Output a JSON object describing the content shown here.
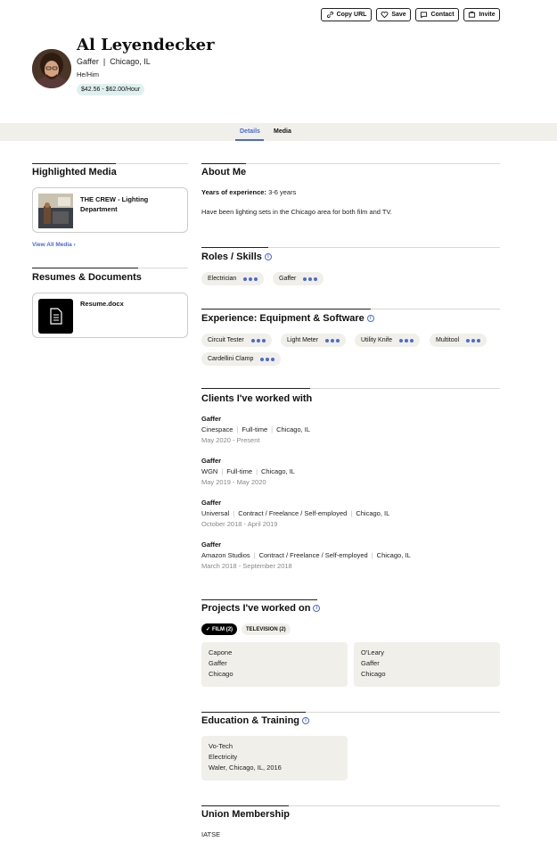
{
  "header": {
    "copy_url": "Copy URL",
    "save": "Save",
    "contact": "Contact",
    "invite": "Invite"
  },
  "profile": {
    "name": "Al Leyendecker",
    "role": "Gaffer",
    "location": "Chicago, IL",
    "pronouns": "He/Him",
    "rate": "$42.56 - $62.00/Hour"
  },
  "tabs": [
    "Details",
    "Media"
  ],
  "sidebar": {
    "highlighted_title": "Highlighted Media",
    "media_item": "THE CREW - Lighting Department",
    "view_all": "View All Media",
    "resumes_title": "Resumes & Documents",
    "resume_file": "Resume.docx"
  },
  "about": {
    "title": "About Me",
    "years_label": "Years of experience:",
    "years_value": "3-6 years",
    "bio": "Have been lighting sets in the Chicago area for both film and TV."
  },
  "roles": {
    "title": "Roles / Skills",
    "items": [
      "Electrician",
      "Gaffer"
    ]
  },
  "equipment": {
    "title": "Experience: Equipment & Software",
    "items": [
      "Circuit Tester",
      "Light Meter",
      "Utility Knife",
      "Multitool",
      "Cardellini Clamp"
    ]
  },
  "clients": {
    "title": "Clients I've worked with",
    "items": [
      {
        "role": "Gaffer",
        "company": "Cinespace",
        "type": "Full-time",
        "location": "Chicago, IL",
        "dates": "May 2020 - Present"
      },
      {
        "role": "Gaffer",
        "company": "WGN",
        "type": "Full-time",
        "location": "Chicago, IL",
        "dates": "May 2019 - May 2020"
      },
      {
        "role": "Gaffer",
        "company": "Universal",
        "type": "Contract / Freelance / Self-employed",
        "location": "Chicago, IL",
        "dates": "October 2018 - April 2019"
      },
      {
        "role": "Gaffer",
        "company": "Amazon Studios",
        "type": "Contract / Freelance / Self-employed",
        "location": "Chicago, IL",
        "dates": "March 2018 - September 2018"
      }
    ]
  },
  "projects": {
    "title": "Projects I've worked on",
    "filter_film": "FILM (2)",
    "filter_tv": "TELEVISION (2)",
    "items": [
      {
        "title": "Capone",
        "role": "Gaffer",
        "location": "Chicago"
      },
      {
        "title": "O'Leary",
        "role": "Gaffer",
        "location": "Chicago"
      }
    ]
  },
  "education": {
    "title": "Education & Training",
    "school": "Vo-Tech",
    "field": "Electricity",
    "detail": "Waler, Chicago, IL, 2016"
  },
  "union": {
    "title": "Union Membership",
    "value": "IATSE"
  },
  "colors": {
    "accent": "#4a6ad4",
    "tabbar": "#f0efe9",
    "rate_badge": "#dff1ef"
  }
}
